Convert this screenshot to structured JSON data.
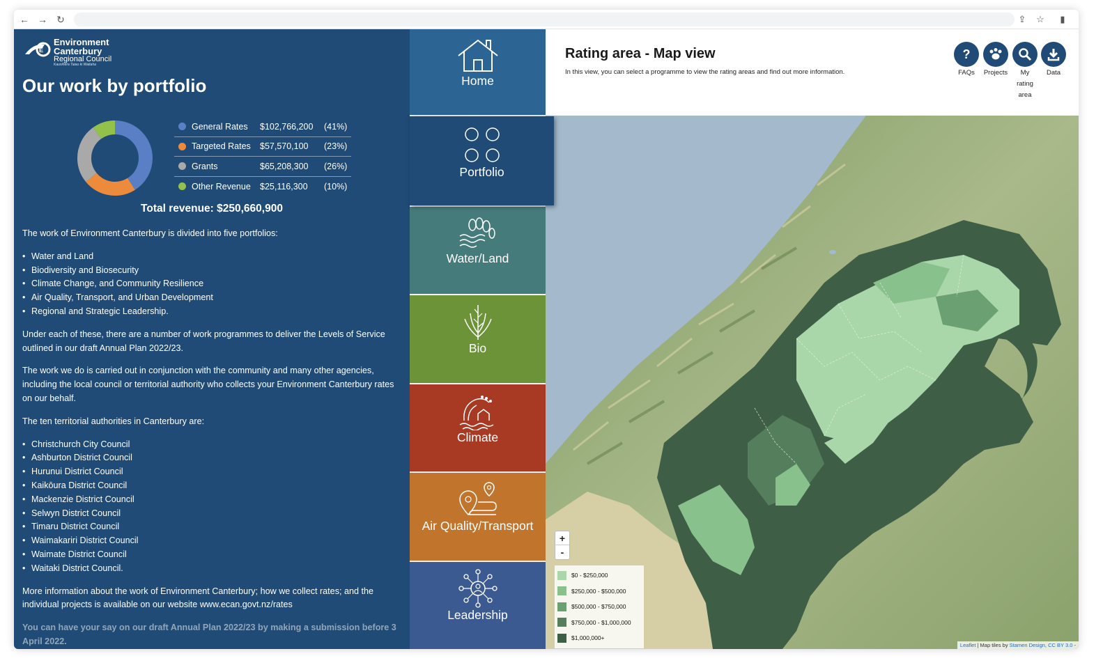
{
  "browser": {
    "back_icon": "←",
    "forward_icon": "→",
    "reload_icon": "↻",
    "share_icon": "⇪",
    "star_icon": "☆",
    "sidebar_icon": "▮"
  },
  "sidebar": {
    "logo": {
      "line1": "Environment",
      "line2": "Canterbury",
      "line3": "Regional Council",
      "line4": "Kaunihera Taiao ki Waitaha"
    },
    "title": "Our work by portfolio",
    "revenue": [
      {
        "name": "General Rates",
        "amount": "$102,766,200",
        "pct": "(41%)",
        "value": 41,
        "color": "#5b7fc4"
      },
      {
        "name": "Targeted Rates",
        "amount": "$57,570,100",
        "pct": "(23%)",
        "value": 23,
        "color": "#ed8b3c"
      },
      {
        "name": "Grants",
        "amount": "$65,208,300",
        "pct": "(26%)",
        "value": 26,
        "color": "#a9a9a9"
      },
      {
        "name": "Other Revenue",
        "amount": "$25,116,300",
        "pct": "(10%)",
        "value": 10,
        "color": "#93c24a"
      }
    ],
    "total": "Total revenue: $250,660,900",
    "intro": "The work of Environment Canterbury is divided into five portfolios:",
    "portfolios": [
      "Water and Land",
      "Biodiversity and Biosecurity",
      "Climate Change, and Community Resilience",
      "Air Quality, Transport, and Urban Development",
      "Regional and Strategic Leadership."
    ],
    "para2": "Under each of these, there are a number of work programmes to deliver the Levels of Service outlined in our draft Annual Plan 2022/23.",
    "para3": "The work we do is carried out in conjunction with the community and many other agencies, including the local council or territorial authority who collects your Environment Canterbury rates on our behalf.",
    "para4": "The ten territorial authorities in Canterbury are:",
    "councils": [
      "Christchurch City Council",
      "Ashburton District Council",
      "Hurunui District Council",
      "Kaikōura District Council",
      "Mackenzie District Council",
      "Selwyn District Council",
      "Timaru District Council",
      "Waimakariri District Council",
      "Waimate District Council",
      "Waitaki District Council."
    ],
    "para5": "More information about the work of Environment Canterbury; how we collect rates; and the individual projects is available on our website www.ecan.govt.nz/rates",
    "para6": "You can have your say on our draft Annual Plan 2022/23 by making a submission before 3 April 2022."
  },
  "tiles": [
    {
      "label": "Home",
      "icon": "house-icon",
      "color": "#2c6494"
    },
    {
      "label": "Portfolio",
      "icon": "four-circles-icon",
      "color": "#1f4b76"
    },
    {
      "label": "Water/Land",
      "icon": "water-land-icon",
      "color": "#467b7c"
    },
    {
      "label": "Bio",
      "icon": "plant-icon",
      "color": "#6d9338"
    },
    {
      "label": "Climate",
      "icon": "climate-icon",
      "color": "#a83a24"
    },
    {
      "label": "Air Quality/Transport",
      "icon": "route-pin-icon",
      "color": "#c0742c"
    },
    {
      "label": "Leadership",
      "icon": "network-people-icon",
      "color": "#3c5a92"
    }
  ],
  "map": {
    "title": "Rating area - Map view",
    "subtitle": "In this view, you can select a programme to view the rating areas and find out more information.",
    "buttons": [
      {
        "label": "FAQs",
        "icon": "question-icon"
      },
      {
        "label": "Projects",
        "icon": "paw-icon"
      },
      {
        "label": "My rating area",
        "icon": "magnifier-icon"
      },
      {
        "label": "Data",
        "icon": "download-icon"
      }
    ],
    "zoom_in": "+",
    "zoom_out": "-",
    "legend": [
      {
        "label": "$0 - $250,000",
        "color": "#a9d7a9"
      },
      {
        "label": "$250,000 - $500,000",
        "color": "#88c18c"
      },
      {
        "label": "$500,000 - $750,000",
        "color": "#6ba072"
      },
      {
        "label": "$750,000 - $1,000,000",
        "color": "#557e5c"
      },
      {
        "label": "$1,000,000+",
        "color": "#3e5f46"
      }
    ],
    "attribution_leaflet": "Leaflet",
    "attribution_text": " | Map tiles by ",
    "attribution_link": "Stamen Design, CC BY 3.0",
    "attribution_end": " -"
  }
}
